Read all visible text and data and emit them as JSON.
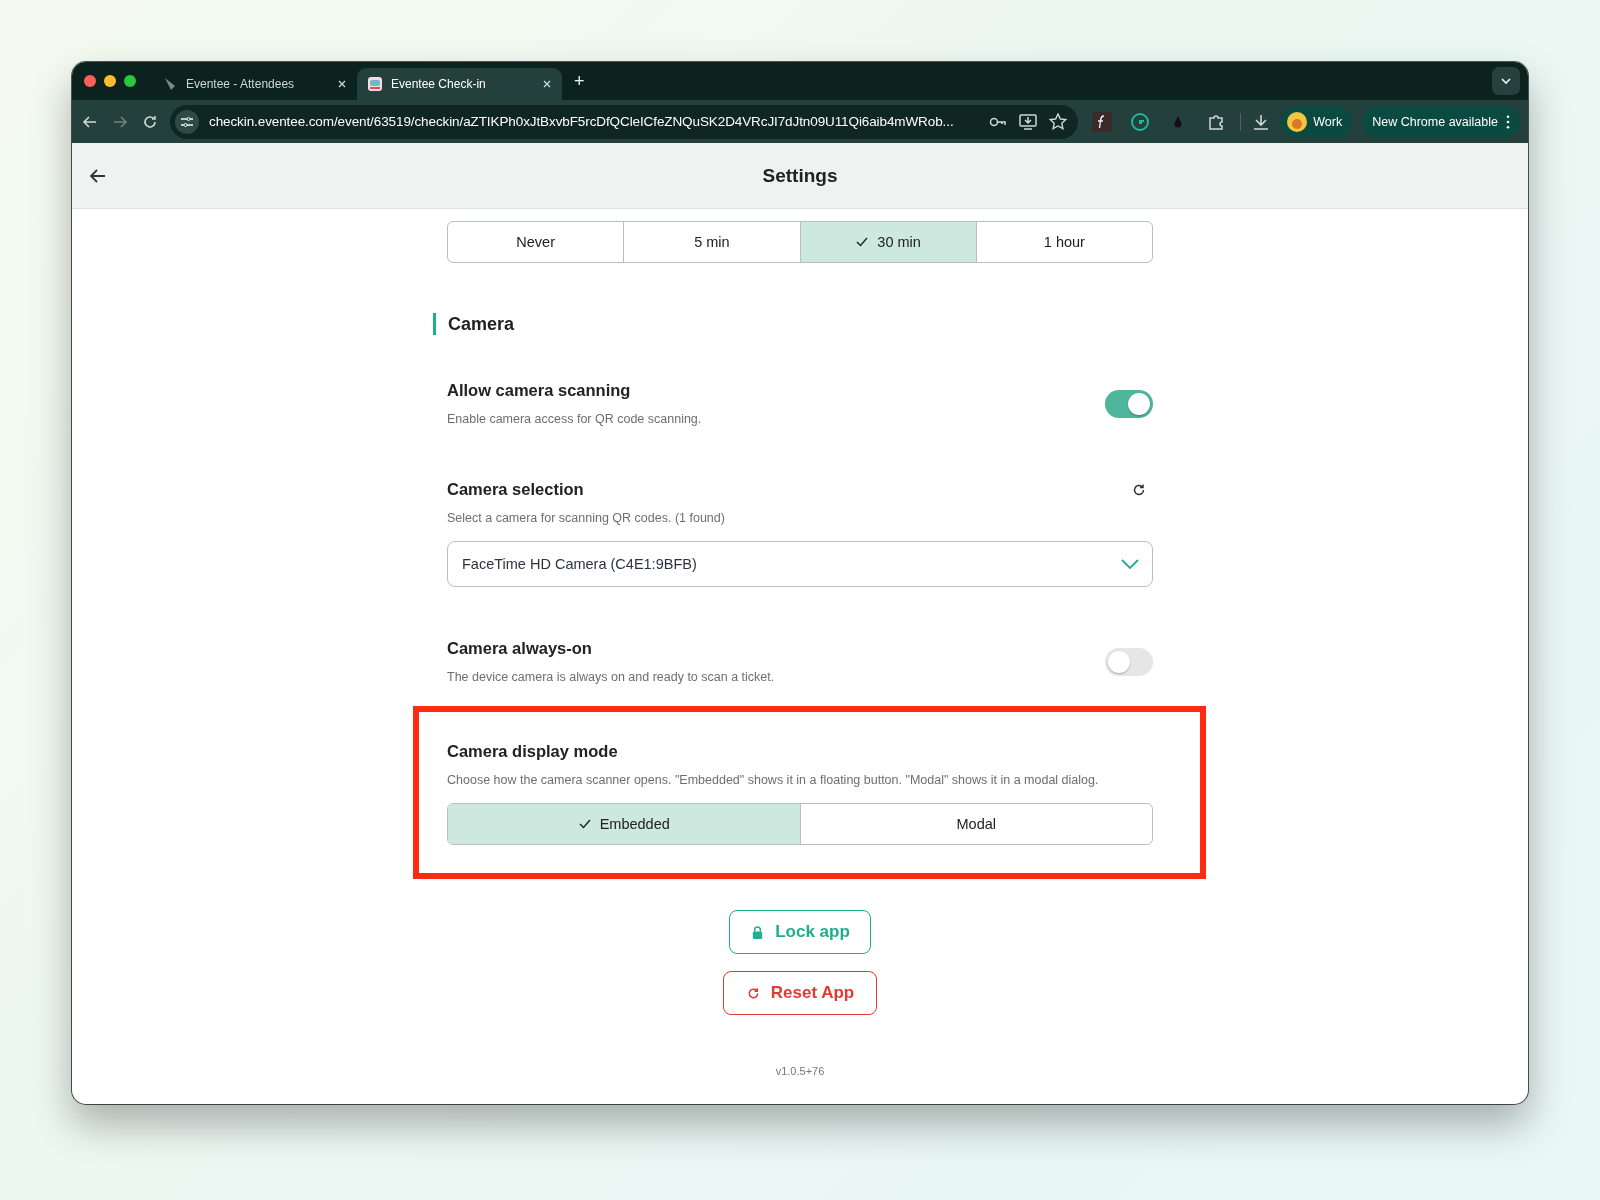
{
  "browser": {
    "tabs": [
      {
        "title": "Eventee - Attendees",
        "selected": false
      },
      {
        "title": "Eventee Check-in",
        "selected": true
      }
    ],
    "new_tab": "+",
    "url": "checkin.eventee.com/event/63519/checkin/aZTIKPh0xJtBxvbF5rcDfQCleICfeZNQuSK2D4VRcJI7dJtn09U11Qi6aib4mWRob...",
    "profile": "Work",
    "update_notice": "New Chrome available"
  },
  "header": {
    "title": "Settings"
  },
  "timeout_options": [
    {
      "label": "Never",
      "selected": false
    },
    {
      "label": "5 min",
      "selected": false
    },
    {
      "label": "30 min",
      "selected": true
    },
    {
      "label": "1 hour",
      "selected": false
    }
  ],
  "section": {
    "title": "Camera"
  },
  "settings": [
    {
      "kind": "toggle",
      "title": "Allow camera scanning",
      "description": "Enable camera access for QR code scanning.",
      "on": true
    },
    {
      "kind": "select",
      "title": "Camera selection",
      "description": "Select a camera for scanning QR codes. (1 found)",
      "value": "FaceTime HD Camera (C4E1:9BFB)"
    },
    {
      "kind": "toggle",
      "title": "Camera always-on",
      "description": "The device camera is always on and ready to scan a ticket.",
      "on": false
    },
    {
      "kind": "segmented",
      "title": "Camera display mode",
      "description": "Choose how the camera scanner opens. \"Embedded\" shows it in a floating button. \"Modal\" shows it in a modal dialog.",
      "highlighted": true,
      "options": [
        {
          "label": "Embedded",
          "selected": true
        },
        {
          "label": "Modal",
          "selected": false
        }
      ]
    }
  ],
  "buttons": [
    {
      "kind": "lock",
      "label": "Lock app"
    },
    {
      "kind": "reset",
      "label": "Reset App"
    }
  ],
  "version": "v1.0.5+76"
}
